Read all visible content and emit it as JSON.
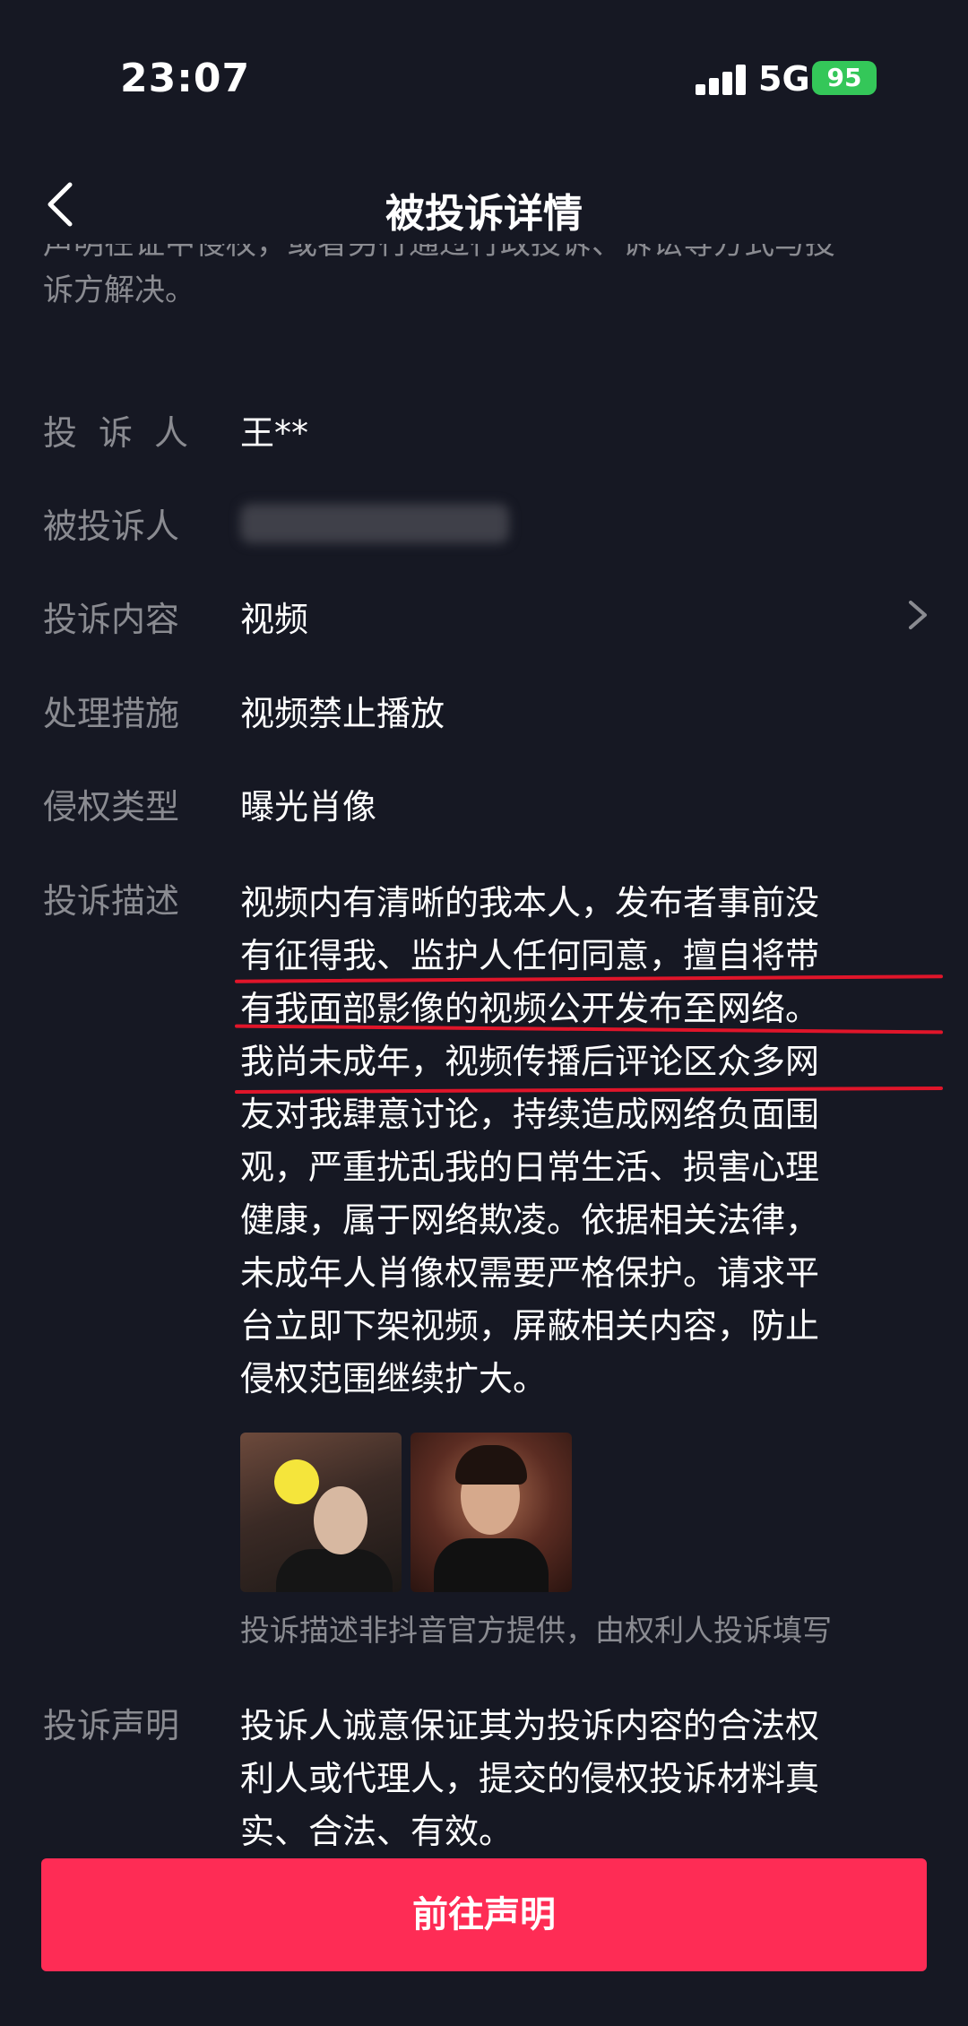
{
  "status_bar": {
    "time": "23:07",
    "network": "5G",
    "battery": "95"
  },
  "nav": {
    "title": "被投诉详情"
  },
  "previous_text": {
    "lines": [
      "声明在证中侵权，或者另行通过行政投诉、诉讼等方式与投",
      "诉方解决。"
    ]
  },
  "fields": {
    "complainant": {
      "label": "投诉人",
      "value": "王**"
    },
    "respondent": {
      "label": "被投诉人"
    },
    "content": {
      "label": "投诉内容",
      "value": "视频"
    },
    "measure": {
      "label": "处理措施",
      "value": "视频禁止播放"
    },
    "type": {
      "label": "侵权类型",
      "value": "曝光肖像"
    },
    "description": {
      "label": "投诉描述",
      "lines": [
        "视频内有清晰的我本人，发布者事前没",
        "有征得我、监护人任何同意，擅自将带",
        "有我面部影像的视频公开发布至网络。",
        "我尚未成年，视频传播后评论区众多网",
        "友对我肆意讨论，持续造成网络负面围",
        "观，严重扰乱我的日常生活、损害心理",
        "健康，属于网络欺凌。依据相关法律，",
        "未成年人肖像权需要严格保护。请求平",
        "台立即下架视频，屏蔽相关内容，防止",
        "侵权范围继续扩大。"
      ],
      "note": "投诉描述非抖音官方提供，由权利人投诉填写"
    },
    "statement": {
      "label": "投诉声明",
      "lines": [
        "投诉人诚意保证其为投诉内容的合法权",
        "利人或代理人，提交的侵权投诉材料真",
        "实、合法、有效。"
      ]
    }
  },
  "cta": {
    "label": "前往声明"
  },
  "colors": {
    "background": "#161823",
    "accent": "#fe2c55",
    "underline": "#e0152a",
    "muted": "#8a8b91"
  }
}
